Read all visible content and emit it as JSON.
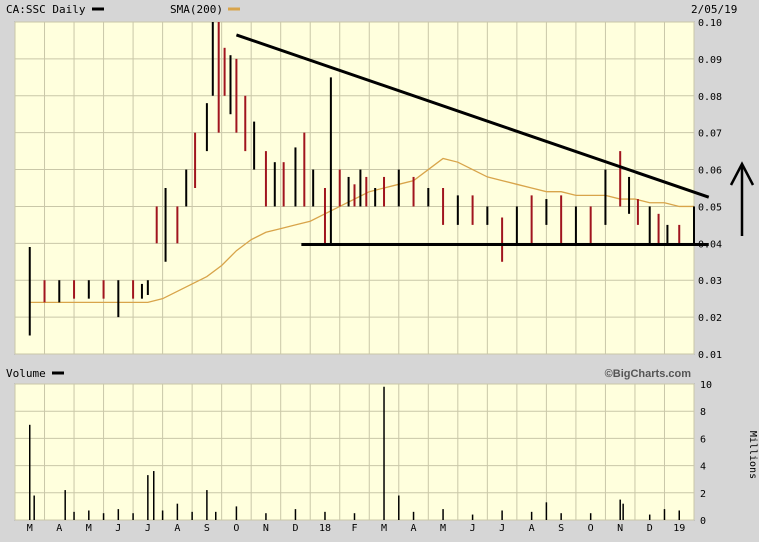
{
  "header": {
    "symbol_label": "CA:SSC Daily",
    "sma_label": "SMA(200)",
    "date": "2/05/19",
    "volume_label": "Volume",
    "brand": "©BigCharts.com",
    "millions_label": "Millions"
  },
  "colors": {
    "background": "#d6d6d6",
    "plot_bg": "#ffffdd",
    "grid": "#c9c7a8",
    "price_up": "#000000",
    "price_down": "#a0141e",
    "sma": "#d8a44a",
    "trend": "#000000"
  },
  "chart_data": [
    {
      "type": "line",
      "panel": "price",
      "y_ticks": [
        "0.10",
        "0.09",
        "0.08",
        "0.07",
        "0.06",
        "0.05",
        "0.04",
        "0.03",
        "0.02",
        "0.01"
      ],
      "ylim": [
        0.01,
        0.1
      ],
      "x_ticks": [
        "M",
        "A",
        "M",
        "J",
        "J",
        "A",
        "S",
        "O",
        "N",
        "D",
        "18",
        "F",
        "M",
        "A",
        "M",
        "J",
        "J",
        "A",
        "S",
        "O",
        "N",
        "D",
        "19"
      ],
      "grid": true,
      "series": [
        {
          "name": "CA:SSC Daily",
          "type": "ohlc-bars",
          "x": [
            0,
            0.5,
            1,
            1.5,
            2,
            2.5,
            3,
            3.5,
            3.8,
            4,
            4.3,
            4.6,
            5,
            5.3,
            5.6,
            6,
            6.2,
            6.4,
            6.6,
            6.8,
            7,
            7.3,
            7.6,
            8,
            8.3,
            8.6,
            9,
            9.3,
            9.6,
            10,
            10.2,
            10.5,
            10.8,
            11,
            11.2,
            11.4,
            11.7,
            12,
            12.5,
            13,
            13.5,
            14,
            14.5,
            15,
            15.5,
            16,
            16.5,
            17,
            17.5,
            18,
            18.5,
            19,
            19.5,
            20,
            20.3,
            20.6,
            21,
            21.3,
            21.6,
            22,
            22.5
          ],
          "high": [
            0.039,
            0.03,
            0.03,
            0.03,
            0.03,
            0.03,
            0.03,
            0.03,
            0.029,
            0.03,
            0.05,
            0.055,
            0.05,
            0.06,
            0.07,
            0.078,
            0.1,
            0.1,
            0.093,
            0.091,
            0.09,
            0.08,
            0.073,
            0.065,
            0.062,
            0.062,
            0.066,
            0.07,
            0.06,
            0.055,
            0.085,
            0.06,
            0.058,
            0.056,
            0.06,
            0.058,
            0.055,
            0.058,
            0.06,
            0.058,
            0.055,
            0.055,
            0.053,
            0.053,
            0.05,
            0.047,
            0.05,
            0.053,
            0.052,
            0.053,
            0.05,
            0.05,
            0.06,
            0.065,
            0.058,
            0.052,
            0.05,
            0.048,
            0.045,
            0.045,
            0.05
          ],
          "low": [
            0.015,
            0.024,
            0.024,
            0.025,
            0.025,
            0.025,
            0.02,
            0.025,
            0.025,
            0.026,
            0.04,
            0.035,
            0.04,
            0.05,
            0.055,
            0.065,
            0.08,
            0.07,
            0.08,
            0.075,
            0.07,
            0.065,
            0.06,
            0.05,
            0.05,
            0.05,
            0.05,
            0.05,
            0.05,
            0.04,
            0.04,
            0.05,
            0.05,
            0.05,
            0.05,
            0.05,
            0.05,
            0.05,
            0.05,
            0.05,
            0.05,
            0.045,
            0.045,
            0.045,
            0.045,
            0.035,
            0.04,
            0.04,
            0.045,
            0.04,
            0.04,
            0.04,
            0.045,
            0.05,
            0.048,
            0.045,
            0.04,
            0.04,
            0.04,
            0.04,
            0.04
          ],
          "up": [
            true,
            false,
            true,
            false,
            true,
            false,
            true,
            false,
            true,
            true,
            false,
            true,
            false,
            true,
            false,
            true,
            true,
            false,
            false,
            true,
            false,
            false,
            true,
            false,
            true,
            false,
            true,
            false,
            true,
            false,
            true,
            false,
            true,
            false,
            true,
            false,
            true,
            false,
            true,
            false,
            true,
            false,
            true,
            false,
            true,
            false,
            true,
            false,
            true,
            false,
            true,
            false,
            true,
            false,
            true,
            false,
            true,
            false,
            true,
            false,
            true
          ]
        },
        {
          "name": "SMA(200)",
          "type": "line",
          "x": [
            0,
            2,
            4,
            4.5,
            5,
            5.5,
            6,
            6.5,
            7,
            7.5,
            8,
            8.5,
            9,
            9.5,
            10,
            10.5,
            11,
            11.5,
            12,
            12.5,
            13,
            13.5,
            14,
            14.5,
            15,
            15.5,
            16,
            16.5,
            17,
            17.5,
            18,
            18.5,
            19,
            19.5,
            20,
            20.5,
            21,
            21.5,
            22,
            22.5
          ],
          "y": [
            0.024,
            0.024,
            0.024,
            0.025,
            0.027,
            0.029,
            0.031,
            0.034,
            0.038,
            0.041,
            0.043,
            0.044,
            0.045,
            0.046,
            0.048,
            0.05,
            0.052,
            0.054,
            0.055,
            0.056,
            0.057,
            0.06,
            0.063,
            0.062,
            0.06,
            0.058,
            0.057,
            0.056,
            0.055,
            0.054,
            0.054,
            0.053,
            0.053,
            0.053,
            0.052,
            0.052,
            0.051,
            0.051,
            0.05,
            0.05
          ]
        },
        {
          "name": "",
          "type": "trendline",
          "x": [
            7.0,
            23.0
          ],
          "y": [
            0.0965,
            0.0525
          ]
        },
        {
          "name": "",
          "type": "trendline",
          "x": [
            9.2,
            23.0
          ],
          "y": [
            0.0397,
            0.0397
          ]
        }
      ]
    },
    {
      "type": "bar",
      "panel": "volume",
      "y_ticks": [
        "10",
        "8",
        "6",
        "4",
        "2",
        "0"
      ],
      "ylim": [
        0,
        10
      ],
      "ylabel": "Millions",
      "x": [
        0,
        0.15,
        1.2,
        1.5,
        2,
        2.5,
        3,
        3.5,
        4,
        4.2,
        4.5,
        5,
        5.5,
        6,
        6.3,
        7,
        8,
        9,
        10,
        11,
        12,
        12.5,
        13,
        14,
        15,
        16,
        17,
        17.5,
        18,
        19,
        20,
        20.1,
        21,
        21.5,
        22
      ],
      "values": [
        7.0,
        1.8,
        2.2,
        0.6,
        0.7,
        0.5,
        0.8,
        0.5,
        3.3,
        3.6,
        0.7,
        1.2,
        0.6,
        2.2,
        0.6,
        1.0,
        0.5,
        0.8,
        0.6,
        0.5,
        9.8,
        1.8,
        0.6,
        0.8,
        0.4,
        0.7,
        0.6,
        1.3,
        0.5,
        0.5,
        1.5,
        1.2,
        0.4,
        0.8,
        0.7
      ]
    }
  ]
}
